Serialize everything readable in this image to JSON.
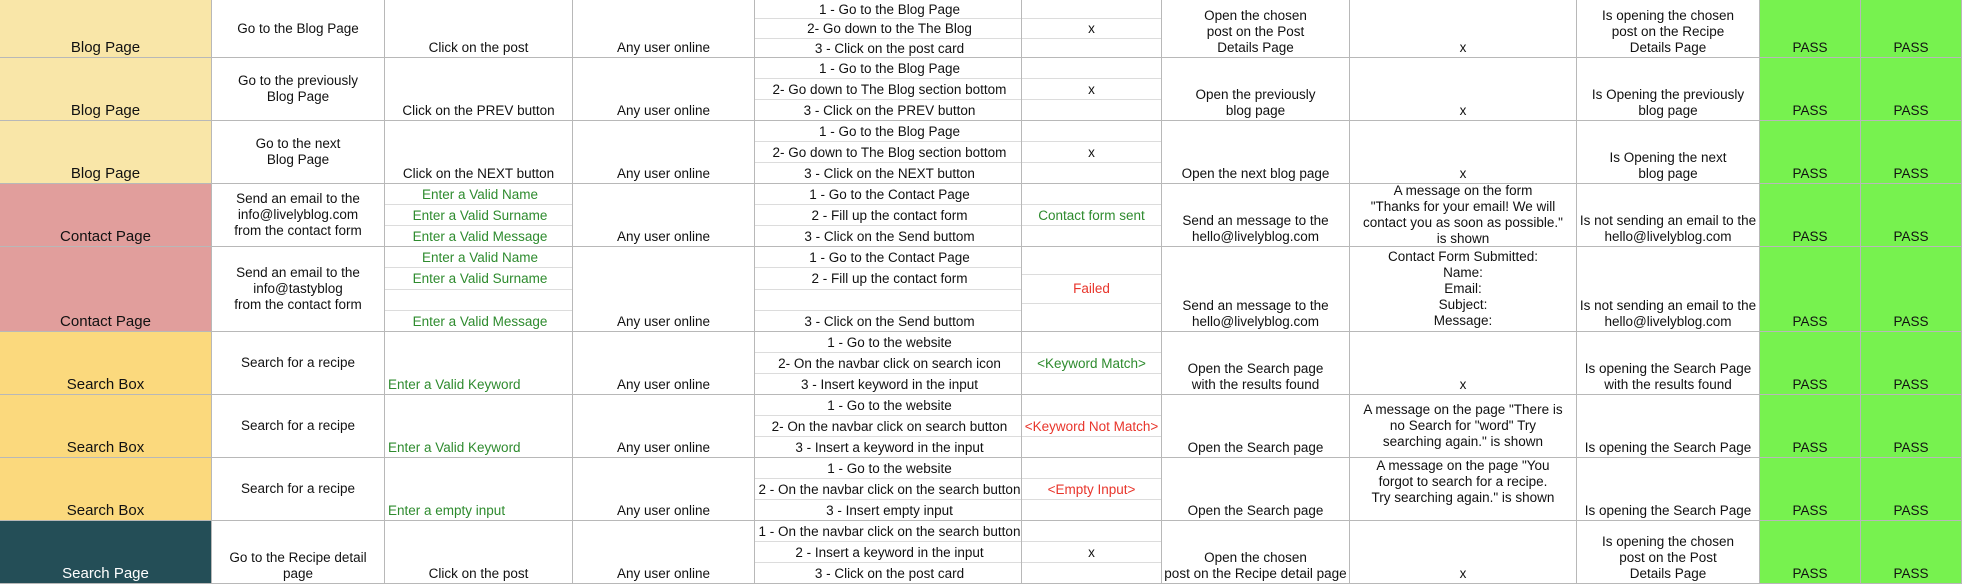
{
  "colors": {
    "blog": "#f9e6a8",
    "contact": "#e19e9c",
    "search_box": "#fbd97d",
    "search_page": "#244e57",
    "pass": "#77f24f",
    "green_text": "#2e8b2e",
    "red_text": "#e8352b"
  },
  "rows": [
    {
      "module": "Blog Page",
      "module_color": "blog",
      "scenario": "Go to the Blog Page",
      "test_data": [
        "Click on the post"
      ],
      "test_data_style": "plain",
      "precondition": "Any user online",
      "steps": [
        "1 - Go to the Blog Page",
        "2- Go down to the The Blog",
        "3 - Click on the post card"
      ],
      "data": "x",
      "data_style": "plain",
      "expected": "Open the chosen\npost on the Post\nDetails Page",
      "actual": "x",
      "actual_align": "bottom",
      "result": "Is opening the chosen\npost on the Recipe\nDetails Page",
      "status1": "PASS",
      "status2": "PASS"
    },
    {
      "module": "Blog Page",
      "module_color": "blog",
      "scenario": "Go to the previously\nBlog Page",
      "test_data": [
        "Click on the PREV button"
      ],
      "test_data_style": "plain",
      "precondition": "Any user online",
      "steps": [
        "1 - Go to the Blog Page",
        "2- Go down to The Blog section bottom",
        "3 - Click on the PREV button"
      ],
      "data": "x",
      "data_style": "plain",
      "expected": "Open the previously\nblog page",
      "actual": "x",
      "actual_align": "bottom",
      "result": "Is Opening the previously\nblog page",
      "status1": "PASS",
      "status2": "PASS"
    },
    {
      "module": "Blog Page",
      "module_color": "blog",
      "scenario": "Go to the next\nBlog Page",
      "test_data": [
        "Click on the NEXT button"
      ],
      "test_data_style": "plain",
      "precondition": "Any user online",
      "steps": [
        "1 - Go to the Blog Page",
        "2- Go down to The Blog section bottom",
        "3 - Click on the NEXT button"
      ],
      "data": "x",
      "data_style": "plain",
      "expected": "Open the next blog page",
      "actual": "x",
      "actual_align": "bottom",
      "result": "Is Opening the next\nblog page",
      "status1": "PASS",
      "status2": "PASS"
    },
    {
      "module": "Contact Page",
      "module_color": "contact",
      "scenario": "Send an email to the\ninfo@livelyblog.com\nfrom the contact form",
      "test_data": [
        "Enter a Valid Name",
        "Enter a Valid Surname",
        "Enter a Valid Message"
      ],
      "test_data_style": "green",
      "precondition": "Any user online",
      "steps": [
        "1 - Go to the Contact Page",
        "2 - Fill up the contact form",
        "3 - Click on the Send buttom"
      ],
      "data": "Contact form sent",
      "data_style": "green",
      "expected": "Send an message to the\nhello@livelyblog.com",
      "actual": "A message on the form\n\"Thanks for your email! We will\ncontact you as soon as possible.\"\nis shown",
      "actual_align": "center",
      "result": "Is not sending an email to the\nhello@livelyblog.com",
      "status1": "PASS",
      "status2": "PASS"
    },
    {
      "module": "Contact Page",
      "module_color": "contact",
      "scenario": "Send an email to the\ninfo@tastyblog\nfrom the contact form",
      "test_data": [
        "Enter a Valid Name",
        "Enter a Valid Surname",
        "",
        "Enter a Valid Message"
      ],
      "test_data_style": "green",
      "precondition": "Any user online",
      "steps": [
        "1 - Go to the Contact Page",
        "2 - Fill up the contact form",
        "",
        "3 - Click on the Send buttom"
      ],
      "data": "Failed",
      "data_style": "red",
      "expected": "Send an message to the\nhello@livelyblog.com",
      "actual": "Contact Form Submitted:\nName:\nEmail:\nSubject:\nMessage:",
      "actual_align": "center",
      "result": "Is not sending an email to the\nhello@livelyblog.com",
      "status1": "PASS",
      "status2": "PASS"
    },
    {
      "module": "Search Box",
      "module_color": "search_box",
      "scenario": "Search for a recipe",
      "test_data": [
        "Enter a Valid Keyword"
      ],
      "test_data_style": "green",
      "precondition": "Any user online",
      "steps": [
        "1 - Go to the website",
        "2- On the navbar click on search icon",
        "3 - Insert keyword in the input"
      ],
      "data": "<Keyword Match>",
      "data_style": "green",
      "expected": "Open the Search page\nwith the results found",
      "actual": "x",
      "actual_align": "bottom",
      "result": "Is opening the Search Page\nwith the results found",
      "status1": "PASS",
      "status2": "PASS"
    },
    {
      "module": "Search Box",
      "module_color": "search_box",
      "scenario": "Search for a recipe",
      "test_data": [
        "Enter a Valid Keyword"
      ],
      "test_data_style": "green",
      "precondition": "Any user online",
      "steps": [
        "1 - Go to the website",
        "2- On the navbar click on search button",
        "3 - Insert a keyword in the input"
      ],
      "data": "<Keyword Not Match>",
      "data_style": "red",
      "expected": "Open the Search page",
      "actual": "A message on the page \"There is\nno Search for \"word\" Try\nsearching again.\" is shown",
      "actual_align": "center",
      "result": "Is opening the Search Page",
      "status1": "PASS",
      "status2": "PASS"
    },
    {
      "module": "Search Box",
      "module_color": "search_box",
      "scenario": "Search for a recipe",
      "test_data": [
        "Enter a empty input"
      ],
      "test_data_style": "green",
      "precondition": "Any user online",
      "steps": [
        "1 - Go to the website",
        "2 - On the navbar click on the search button",
        "3 - Insert empty input"
      ],
      "data": "<Empty Input>",
      "data_style": "red",
      "expected": "Open the Search page",
      "actual": "A message on the page \"You\nforgot to search for a recipe.\nTry searching again.\" is shown",
      "actual_align": "top",
      "result": "Is opening the Search Page",
      "status1": "PASS",
      "status2": "PASS"
    },
    {
      "module": "Search Page",
      "module_color": "search_page",
      "scenario": "Go to the Recipe detail page",
      "test_data": [
        "Click on the post"
      ],
      "test_data_style": "plain",
      "precondition": "Any user online",
      "steps": [
        "1 - On the navbar click on the search button",
        "2 - Insert a keyword in the input",
        "3 - Click on the post card"
      ],
      "data": "x",
      "data_style": "plain",
      "expected": "Open the chosen\npost on the Recipe detail page",
      "actual": "x",
      "actual_align": "bottom",
      "result": "Is opening the chosen\npost on the Post\nDetails Page",
      "status1": "PASS",
      "status2": "PASS"
    }
  ]
}
